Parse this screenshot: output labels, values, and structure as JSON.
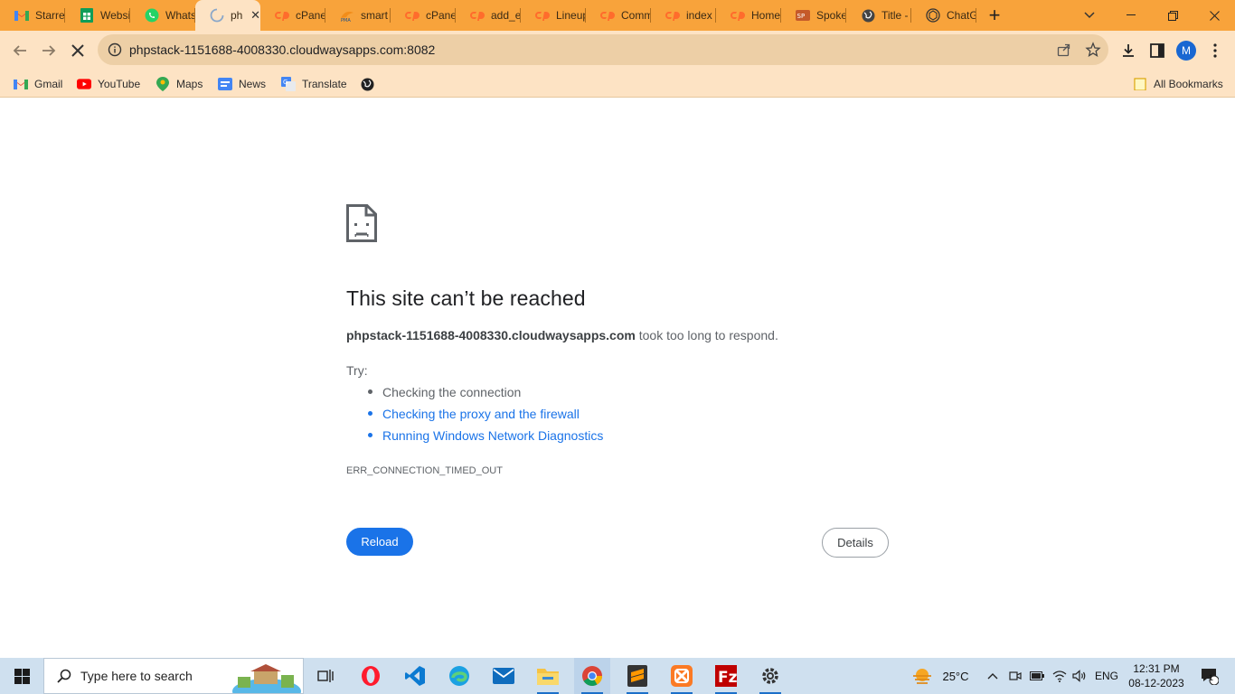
{
  "browser": {
    "tabs": [
      {
        "title": "Starred",
        "icon": "gmail-icon"
      },
      {
        "title": "Website",
        "icon": "sheets-icon"
      },
      {
        "title": "WhatsApp",
        "icon": "whatsapp-icon"
      },
      {
        "title": "phpstack",
        "icon": "loading-spinner-icon",
        "active": true
      },
      {
        "title": "cPanel",
        "icon": "cpanel-icon"
      },
      {
        "title": "smart",
        "icon": "phpmyadmin-icon"
      },
      {
        "title": "cPanel",
        "icon": "cpanel-icon"
      },
      {
        "title": "add_e",
        "icon": "cpanel-icon"
      },
      {
        "title": "Lineup",
        "icon": "cpanel-icon"
      },
      {
        "title": "Comm",
        "icon": "cpanel-icon"
      },
      {
        "title": "index",
        "icon": "cpanel-icon"
      },
      {
        "title": "Home",
        "icon": "cpanel-icon"
      },
      {
        "title": "Spoke",
        "icon": "spoke-icon"
      },
      {
        "title": "Title -",
        "icon": "globe-icon"
      },
      {
        "title": "ChatGPT",
        "icon": "chatgpt-icon"
      }
    ],
    "new_tab_label": "+",
    "url": "phpstack-1151688-4008330.cloudwaysapps.com:8082",
    "profile_initial": "M",
    "bookmarks": [
      {
        "label": "Gmail",
        "icon": "gmail-icon"
      },
      {
        "label": "YouTube",
        "icon": "youtube-icon"
      },
      {
        "label": "Maps",
        "icon": "maps-icon"
      },
      {
        "label": "News",
        "icon": "news-icon"
      },
      {
        "label": "Translate",
        "icon": "translate-icon"
      }
    ],
    "all_bookmarks_label": "All Bookmarks"
  },
  "error_page": {
    "title": "This site can’t be reached",
    "host": "phpstack-1151688-4008330.cloudwaysapps.com",
    "desc_suffix": " took too long to respond.",
    "try_label": "Try:",
    "suggestions": [
      {
        "text": "Checking the connection",
        "link": false
      },
      {
        "text": "Checking the proxy and the firewall",
        "link": true
      },
      {
        "text": "Running Windows Network Diagnostics",
        "link": true
      }
    ],
    "error_code": "ERR_CONNECTION_TIMED_OUT",
    "reload_label": "Reload",
    "details_label": "Details"
  },
  "taskbar": {
    "search_placeholder": "Type here to search",
    "weather": "25°C",
    "language": "ENG",
    "time": "12:31 PM",
    "date": "08-12-2023",
    "notification_count": "1"
  },
  "colors": {
    "tabstrip": "#f8a33b",
    "toolbar": "#fde3c4",
    "reload_button": "#1a73e8",
    "link": "#1a73e8"
  }
}
